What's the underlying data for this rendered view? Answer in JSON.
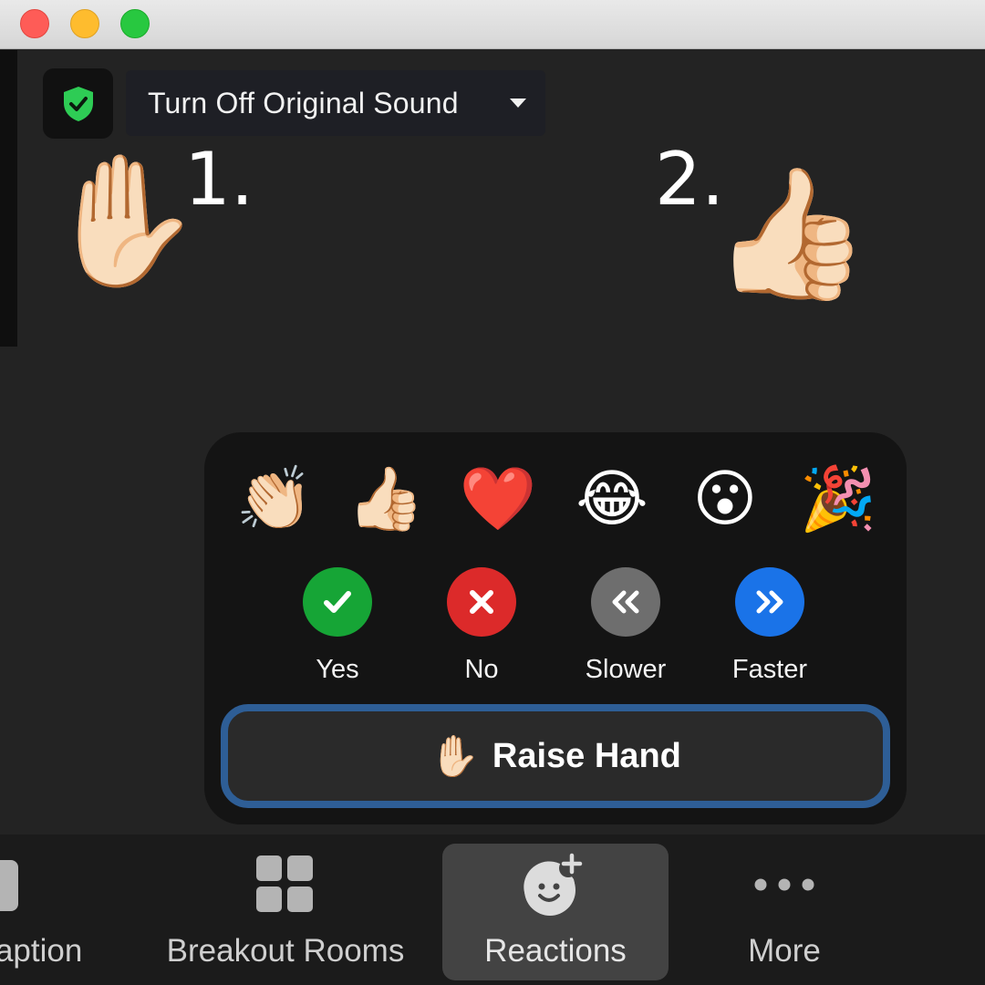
{
  "window": {
    "traffic_lights": [
      "close",
      "minimize",
      "zoom"
    ]
  },
  "top_controls": {
    "security_icon": "shield-check-icon",
    "original_sound_label": "Turn Off Original Sound",
    "dropdown_icon": "caret-down-icon"
  },
  "annotations": {
    "step1_label": "1.",
    "step1_emoji": "✋🏻",
    "step2_label": "2.",
    "step2_emoji": "👍🏻"
  },
  "reactions_popup": {
    "emojis": [
      {
        "name": "clapping-hands",
        "glyph": "👏🏻"
      },
      {
        "name": "thumbs-up",
        "glyph": "👍🏻"
      },
      {
        "name": "heart",
        "glyph": "❤️"
      },
      {
        "name": "tears-of-joy",
        "glyph": "😂"
      },
      {
        "name": "open-mouth",
        "glyph": "😮"
      },
      {
        "name": "party-popper",
        "glyph": "🎉"
      }
    ],
    "feedback": [
      {
        "label": "Yes",
        "icon": "check-icon",
        "color": "#16a536"
      },
      {
        "label": "No",
        "icon": "x-icon",
        "color": "#dc2a2a"
      },
      {
        "label": "Slower",
        "icon": "double-chevron-left-icon",
        "color": "#6e6e6e"
      },
      {
        "label": "Faster",
        "icon": "double-chevron-right-icon",
        "color": "#1a73e8"
      }
    ],
    "raise_hand": {
      "emoji": "✋🏻",
      "label": "Raise Hand"
    },
    "accent_border": "#2e5e96"
  },
  "toolbar": {
    "items": [
      {
        "label": "Caption",
        "icon": "closed-caption-icon",
        "partially_visible": true
      },
      {
        "label": "Breakout Rooms",
        "icon": "breakout-grid-icon"
      },
      {
        "label": "Reactions",
        "icon": "add-reaction-icon",
        "active": true
      },
      {
        "label": "More",
        "icon": "more-dots-icon"
      }
    ]
  }
}
